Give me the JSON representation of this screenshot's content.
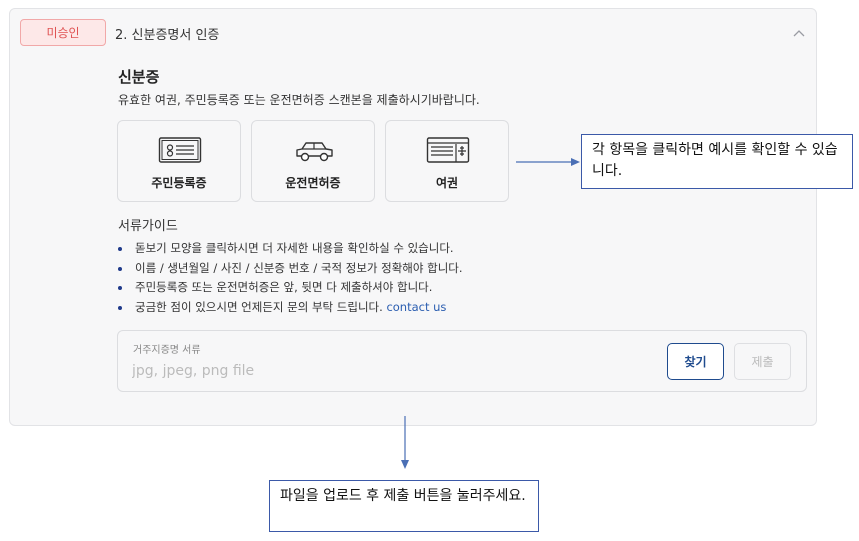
{
  "section": {
    "status_badge": "미승인",
    "step_title": "2. 신분증명서 인증",
    "heading": "신분증",
    "description": "유효한 여권, 주민등록증 또는 운전면허증 스캔본을 제출하시기바랍니다.",
    "doc_types": [
      {
        "label": "주민등록증",
        "icon": "id-card-icon"
      },
      {
        "label": "운전면허증",
        "icon": "car-icon"
      },
      {
        "label": "여권",
        "icon": "passport-icon"
      }
    ]
  },
  "guide": {
    "title": "서류가이드",
    "items": [
      "돋보기 모양을 클릭하시면 더 자세한 내용을 확인하실 수 있습니다.",
      "이름 / 생년월일 / 사진 / 신분증 번호 / 국적 정보가 정확해야 합니다.",
      "주민등록증 또는 운전면허증은 앞, 뒷면 다 제출하셔야 합니다.",
      "궁금한 점이 있으시면 언제든지 문의 부탁 드립니다."
    ],
    "contact_link": "contact us"
  },
  "upload": {
    "label": "거주지증명 서류",
    "placeholder": "jpg, jpeg, png file",
    "find_button": "찾기",
    "submit_button": "제출"
  },
  "annotations": {
    "note_1": "각 항목을 클릭하면 예시를 확인할 수 있습니다.",
    "note_2": "파일을 업로드 후 제출 버튼을 눌러주세요."
  },
  "colors": {
    "badge_text": "#e05252",
    "badge_bg": "#fde8e8",
    "accent": "#1f4b8e",
    "link": "#2a5db0",
    "annotation_border": "#3b59a8"
  }
}
